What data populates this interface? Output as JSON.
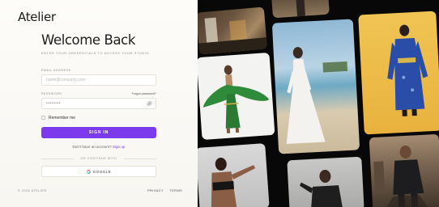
{
  "brand": {
    "logo_text": "Atelier"
  },
  "form": {
    "title": "Welcome Back",
    "subtitle": "Enter your credentials to access your studio",
    "email_label": "Email Address",
    "email_placeholder": "name@company.com",
    "password_label": "Password",
    "password_value": "••••••••",
    "forgot_label": "Forgot password?",
    "remember_label": "Remember me",
    "signin_label": "Sign In",
    "no_account_text": "Don't have an account?",
    "signup_label": "Sign up",
    "divider_text": "Or continue with",
    "google_label": "Google"
  },
  "footer": {
    "copyright": "© 2026 Atelier",
    "privacy": "Privacy",
    "terms": "Terms"
  },
  "colors": {
    "accent": "#7c3aed",
    "gallery_bg": "#080808"
  },
  "gallery": {
    "photos": [
      "studio-interior-photo",
      "portrait-top-photo",
      "green-sari-dancer-photo",
      "white-gown-beach-photo",
      "blue-kimono-portrait-photo",
      "athlete-portrait-photo",
      "sportswear-man-photo",
      "street-fashion-man-photo"
    ]
  }
}
